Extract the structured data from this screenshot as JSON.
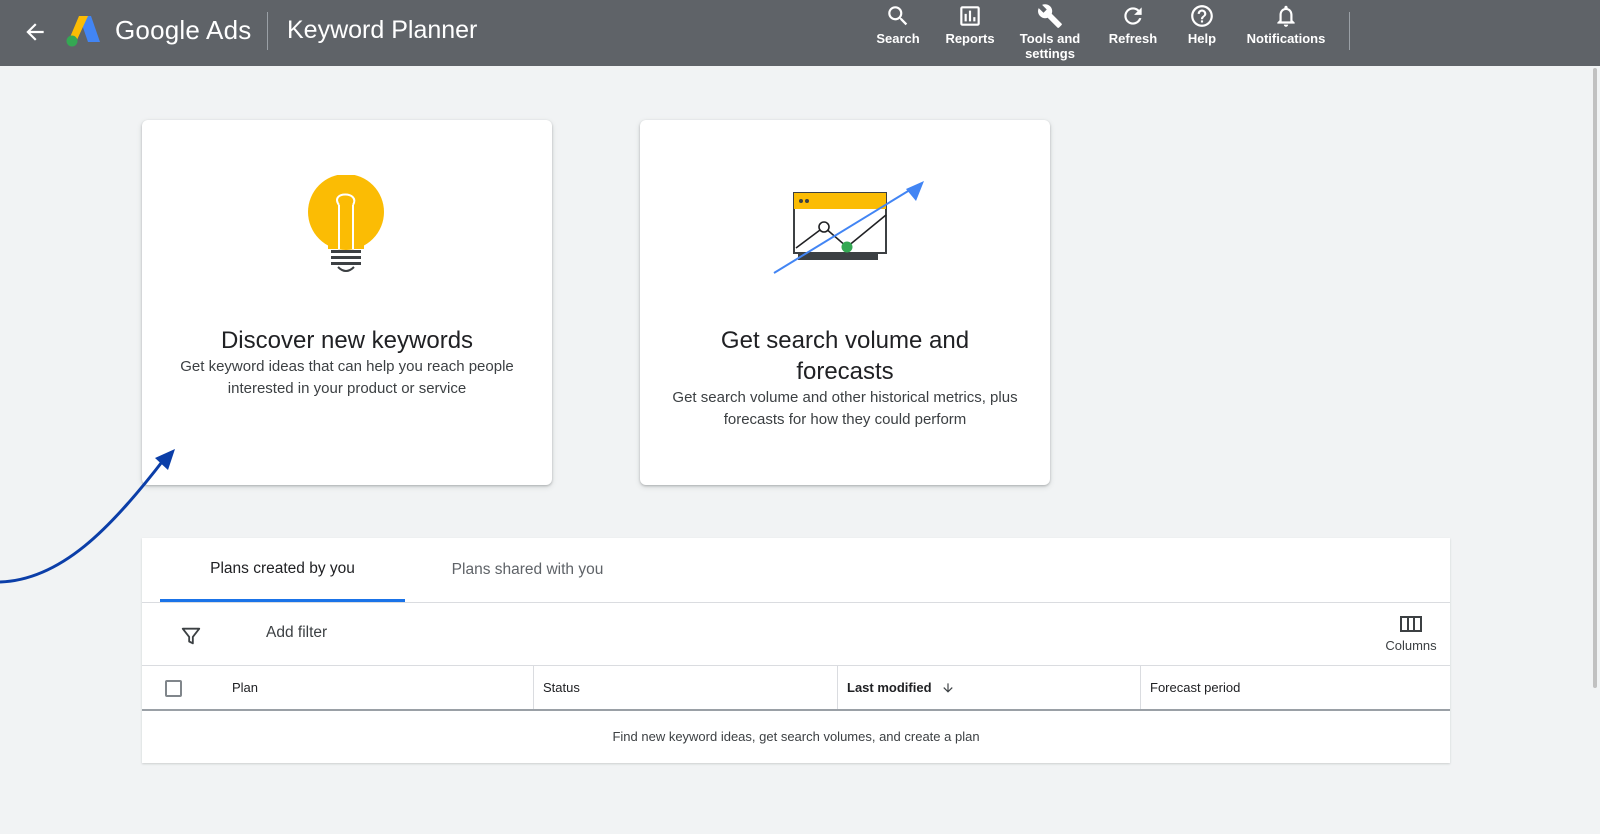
{
  "header": {
    "brand": "Google Ads",
    "page_title": "Keyword Planner",
    "tools": [
      {
        "label": "Search",
        "icon": "search-icon"
      },
      {
        "label": "Reports",
        "icon": "reports-icon"
      },
      {
        "label": "Tools and settings",
        "icon": "wrench-icon"
      },
      {
        "label": "Refresh",
        "icon": "refresh-icon"
      },
      {
        "label": "Help",
        "icon": "help-icon"
      },
      {
        "label": "Notifications",
        "icon": "bell-icon"
      }
    ]
  },
  "cards": [
    {
      "title": "Discover new keywords",
      "description": "Get keyword ideas that can help you reach people interested in your product or service",
      "icon": "lightbulb-icon"
    },
    {
      "title": "Get search volume and forecasts",
      "description": "Get search volume and other historical metrics, plus forecasts for how they could perform",
      "icon": "trend-chart-icon"
    }
  ],
  "plans": {
    "tabs": [
      {
        "label": "Plans created by you",
        "active": true
      },
      {
        "label": "Plans shared with you",
        "active": false
      }
    ],
    "add_filter": "Add filter",
    "columns_label": "Columns",
    "columns": [
      "Plan",
      "Status",
      "Last modified",
      "Forecast period"
    ],
    "empty_message": "Find new keyword ideas, get search volumes, and create a plan"
  },
  "colors": {
    "topbar": "#5f6368",
    "accent": "#1a73e8",
    "bulb": "#fbbc04",
    "annotation_arrow": "#0b3ea8"
  }
}
